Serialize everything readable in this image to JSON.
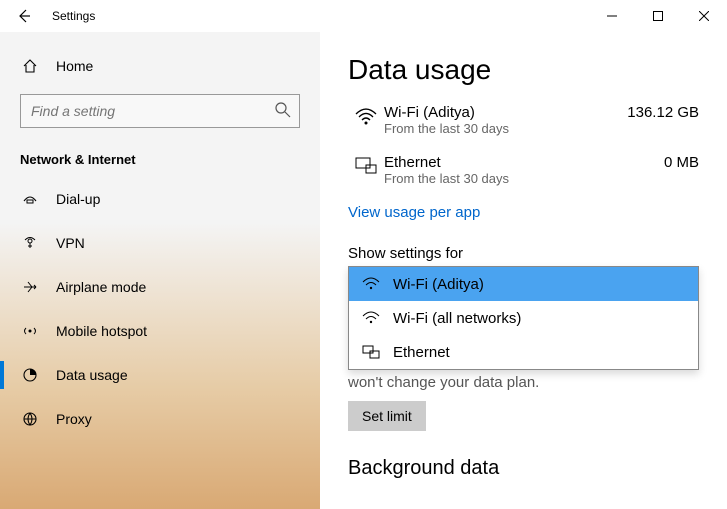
{
  "titlebar": {
    "title": "Settings"
  },
  "sidebar": {
    "home": "Home",
    "search_placeholder": "Find a setting",
    "section": "Network & Internet",
    "items": [
      {
        "label": "Dial-up"
      },
      {
        "label": "VPN"
      },
      {
        "label": "Airplane mode"
      },
      {
        "label": "Mobile hotspot"
      },
      {
        "label": "Data usage"
      },
      {
        "label": "Proxy"
      }
    ]
  },
  "content": {
    "page_title": "Data usage",
    "usage": [
      {
        "name": "Wi-Fi (Aditya)",
        "sub": "From the last 30 days",
        "value": "136.12 GB"
      },
      {
        "name": "Ethernet",
        "sub": "From the last 30 days",
        "value": "0 MB"
      }
    ],
    "view_link": "View usage per app",
    "show_settings_label": "Show settings for",
    "dropdown": [
      {
        "label": "Wi-Fi (Aditya)"
      },
      {
        "label": "Wi-Fi (all networks)"
      },
      {
        "label": "Ethernet"
      }
    ],
    "below_text": "won't change your data plan.",
    "set_limit": "Set limit",
    "background_title": "Background data"
  }
}
